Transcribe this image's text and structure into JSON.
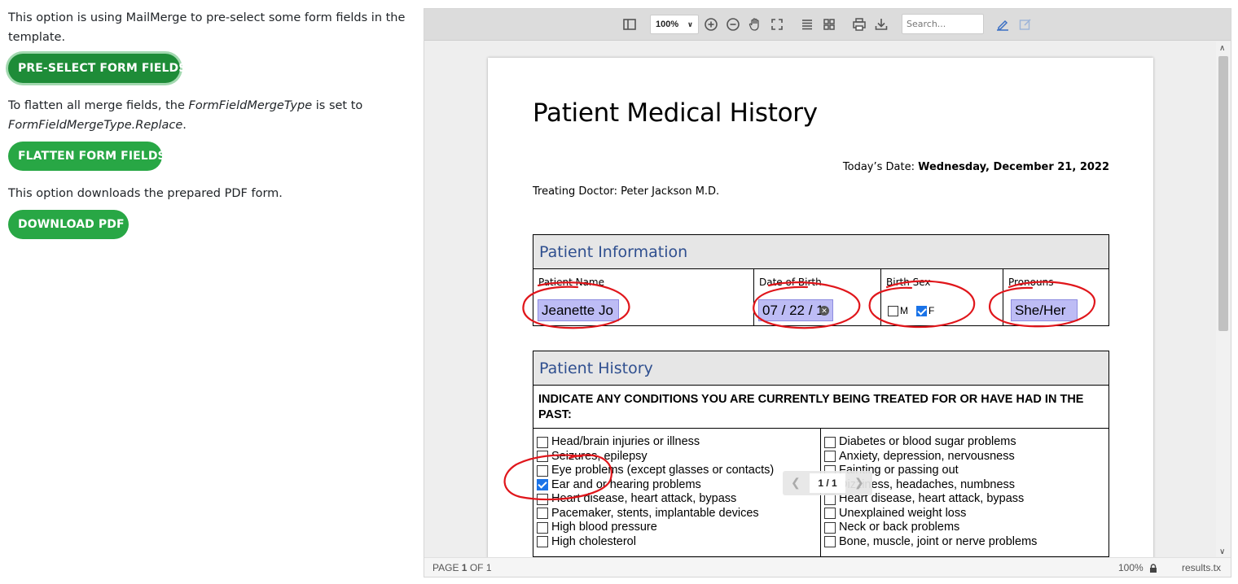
{
  "left": {
    "intro_text": "This option is using MailMerge to pre-select some form fields in the template.",
    "preselect_button": "PRE-SELECT FORM FIELDS",
    "flatten_text_a": "To flatten all merge fields, the ",
    "flatten_text_em1": "FormFieldMergeType",
    "flatten_text_b": " is set to ",
    "flatten_text_em2": "FormFieldMergeType.Replace",
    "flatten_text_c": ".",
    "flatten_button": "FLATTEN FORM FIELDS",
    "download_text": "This option downloads the prepared PDF form.",
    "download_button": "DOWNLOAD PDF",
    "accent_color": "#28a745"
  },
  "toolbar": {
    "zoom_value": "100%",
    "search_placeholder": "Search...",
    "icons": [
      "sidebar-toggle-icon",
      "zoom-in-icon",
      "zoom-out-icon",
      "pan-hand-icon",
      "fit-page-icon",
      "text-view-icon",
      "thumbnails-icon",
      "print-icon",
      "download-icon",
      "edit-sign-icon",
      "form-edit-icon"
    ]
  },
  "document": {
    "title": "Patient Medical History",
    "date_label": "Today’s Date: ",
    "date_value": "Wednesday, December 21, 2022",
    "doctor": "Treating Doctor: Peter Jackson M.D.",
    "patient_info": {
      "header": "Patient Information",
      "name_label": "Patient Name",
      "name_value": "Jeanette Jo",
      "dob_label": "Date of Birth",
      "dob_value": "07 / 22 / 1",
      "sex_label": "Birth Sex",
      "sex_m": "M",
      "sex_f": "F",
      "sex_selected": "F",
      "pronouns_label": "Pronouns",
      "pronouns_value": "She/Her"
    },
    "patient_history": {
      "header": "Patient History",
      "question": "INDICATE ANY CONDITIONS YOU ARE CURRENTLY BEING TREATED FOR OR HAVE HAD IN THE PAST:",
      "left_conditions": [
        {
          "label": "Head/brain injuries or illness",
          "checked": false
        },
        {
          "label": "Seizures, epilepsy",
          "checked": false
        },
        {
          "label": "Eye problems (except glasses or contacts)",
          "checked": false
        },
        {
          "label": "Ear and or hearing problems",
          "checked": true
        },
        {
          "label": "Heart disease, heart attack, bypass",
          "checked": false
        },
        {
          "label": "Pacemaker, stents, implantable devices",
          "checked": false
        },
        {
          "label": "High blood pressure",
          "checked": false
        },
        {
          "label": "High cholesterol",
          "checked": false
        }
      ],
      "right_conditions": [
        {
          "label": "Diabetes or blood sugar problems",
          "checked": false
        },
        {
          "label": "Anxiety, depression, nervousness",
          "checked": false
        },
        {
          "label": "Fainting or passing out",
          "checked": false
        },
        {
          "label": "Dizziness, headaches, numbness",
          "checked": false
        },
        {
          "label": "Heart disease, heart attack, bypass",
          "checked": false
        },
        {
          "label": "Unexplained weight loss",
          "checked": false
        },
        {
          "label": "Neck or back problems",
          "checked": false
        },
        {
          "label": "Bone, muscle, joint or nerve problems",
          "checked": false
        }
      ]
    },
    "pager": {
      "count": "1 / 1"
    }
  },
  "status": {
    "page_prefix": "PAGE ",
    "page_current": "1",
    "page_suffix": " OF 1",
    "zoom": "100%",
    "brand": "results.tx"
  }
}
